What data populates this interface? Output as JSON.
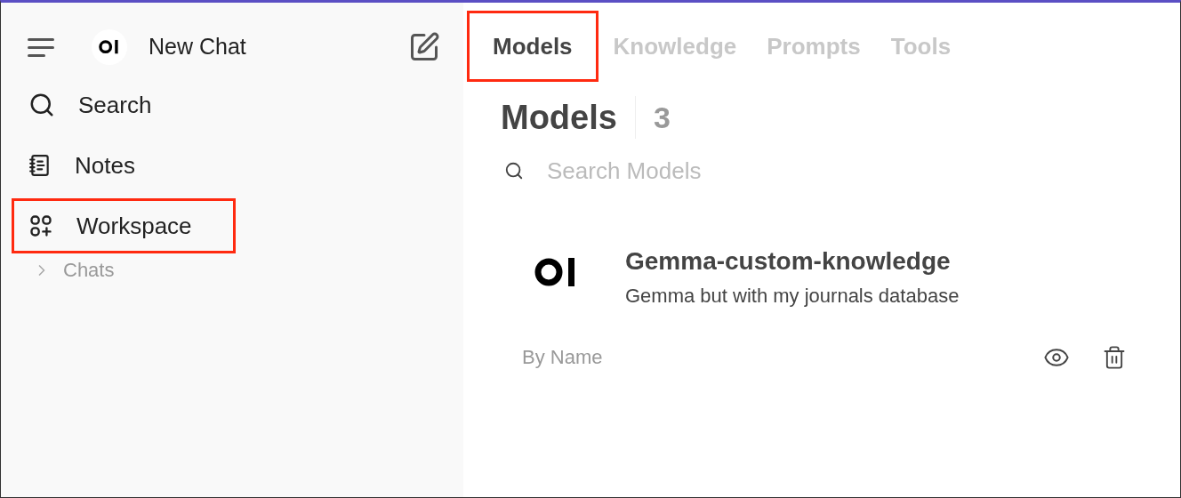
{
  "sidebar": {
    "title": "New Chat",
    "items": [
      {
        "kind": "search",
        "label": "Search",
        "highlighted": false
      },
      {
        "kind": "notes",
        "label": "Notes",
        "highlighted": false
      },
      {
        "kind": "workspace",
        "label": "Workspace",
        "highlighted": true
      }
    ],
    "chats": {
      "label": "Chats",
      "expanded": false
    }
  },
  "tabs": [
    {
      "label": "Models",
      "selected": true,
      "highlighted": true
    },
    {
      "label": "Knowledge",
      "selected": false,
      "highlighted": false
    },
    {
      "label": "Prompts",
      "selected": false,
      "highlighted": false
    },
    {
      "label": "Tools",
      "selected": false,
      "highlighted": false
    }
  ],
  "heading": {
    "title": "Models",
    "count": "3"
  },
  "search": {
    "placeholder": "Search Models"
  },
  "models": [
    {
      "name": "Gemma-custom-knowledge",
      "description": "Gemma but with my journals database",
      "author": "By Name"
    }
  ]
}
